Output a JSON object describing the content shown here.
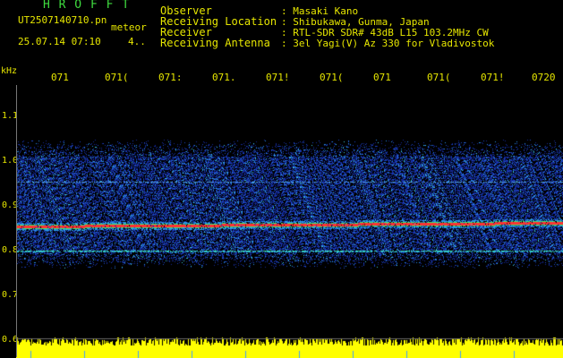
{
  "header": {
    "app_name": "H R O F F T",
    "filename": "UT2507140710.pn",
    "type": "meteor",
    "datetime": "25.07.14 07:10",
    "number": "4..",
    "fields": [
      {
        "label": "Observer",
        "value": ": Masaki Kano"
      },
      {
        "label": "Receiving Location",
        "value": ": Shibukawa, Gunma, Japan"
      },
      {
        "label": "Receiver",
        "value": ": RTL-SDR SDR# 43dB L15 103.2MHz CW"
      },
      {
        "label": "Receiving Antenna",
        "value": ": 3el Yagi(V) Az 330 for Vladivostok"
      }
    ]
  },
  "axis": {
    "unit": "kHz",
    "y_labels": [
      "1.1",
      "1.0",
      "0.9",
      "0.8",
      "0.7",
      "0.6"
    ],
    "time_labels": [
      "071",
      "071(",
      "071:",
      "071.",
      "071!",
      "071(",
      "071",
      "071(",
      "071!",
      "0720"
    ]
  },
  "colors": {
    "text": "#e6e600",
    "title": "#3fdc3f",
    "noise_band": "#1a2fae",
    "signal_line": "#ff3030",
    "signal_halo": "#30e070",
    "bottom_band": "#ffff00"
  }
}
